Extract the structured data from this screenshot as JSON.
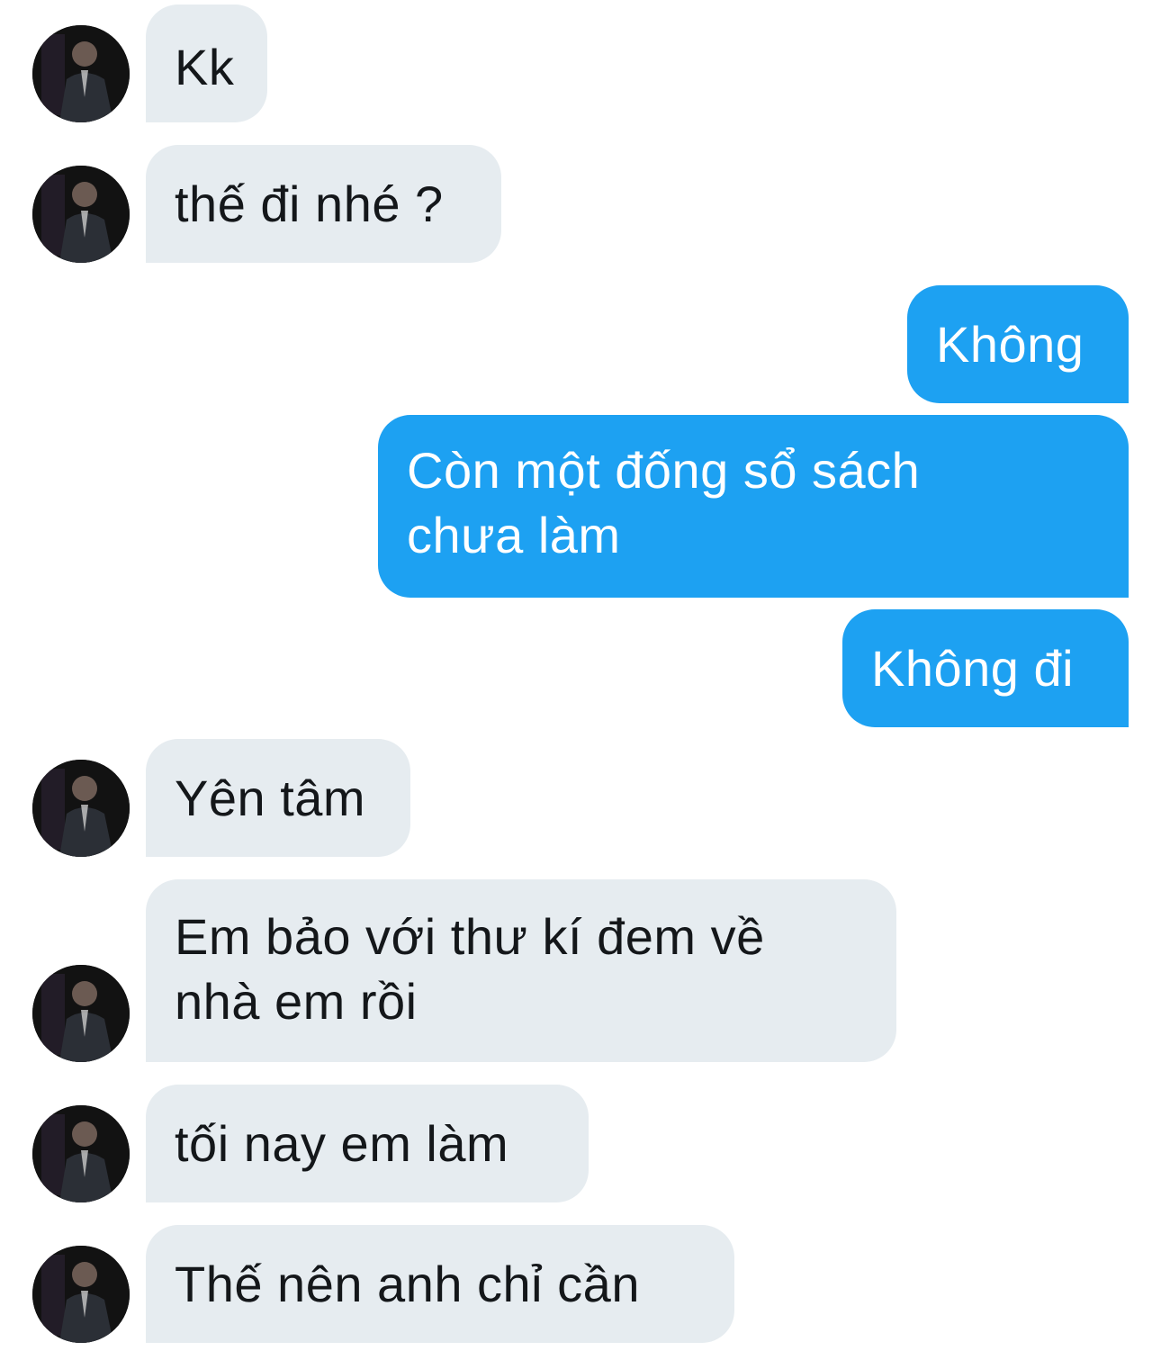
{
  "conversation": {
    "messages": [
      {
        "side": "in",
        "text": "Kk"
      },
      {
        "side": "in",
        "text": "thế đi nhé ?"
      },
      {
        "side": "out",
        "text": "Không"
      },
      {
        "side": "out",
        "lines": [
          "Còn một đống sổ sách",
          "chưa làm"
        ]
      },
      {
        "side": "out",
        "text": "Không đi"
      },
      {
        "side": "in",
        "text": "Yên tâm"
      },
      {
        "side": "in",
        "lines": [
          "Em bảo với thư kí đem về",
          "nhà em rồi"
        ]
      },
      {
        "side": "in",
        "text": "tối nay em làm"
      },
      {
        "side": "in",
        "text": "Thế nên anh chỉ cần"
      }
    ]
  },
  "colors": {
    "incoming_bubble": "#e6ecf0",
    "outgoing_bubble": "#1da1f2",
    "incoming_text": "#14171a",
    "outgoing_text": "#ffffff"
  },
  "icons": {
    "avatar": "user-avatar-photo"
  }
}
